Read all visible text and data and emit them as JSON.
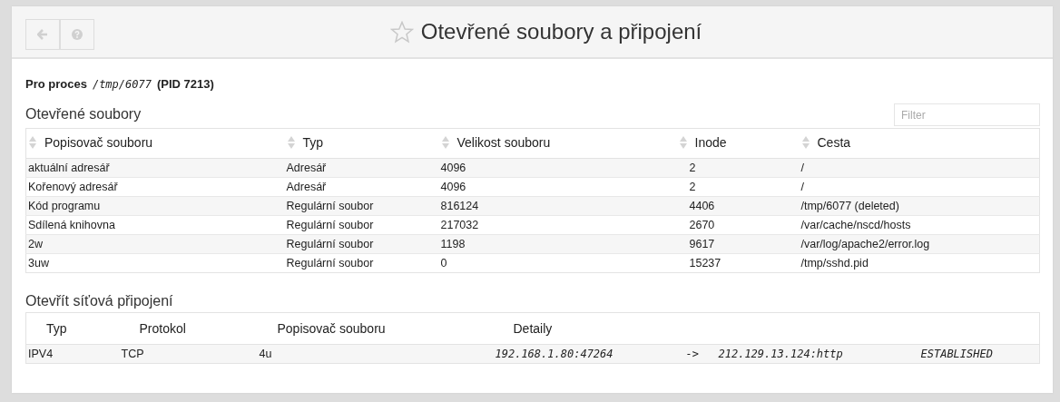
{
  "header": {
    "title": "Otevřené soubory a připojení",
    "favorite": false
  },
  "process": {
    "label": "Pro proces",
    "path": "/tmp/6077",
    "pid": "(PID 7213)"
  },
  "open_files": {
    "heading": "Otevřené soubory",
    "filter": {
      "placeholder": "Filter"
    },
    "columns": [
      "Popisovač souboru",
      "Typ",
      "Velikost souboru",
      "Inode",
      "Cesta"
    ],
    "rows": [
      [
        "aktuální adresář",
        "Adresář",
        "4096",
        "2",
        "/"
      ],
      [
        "Kořenový adresář",
        "Adresář",
        "4096",
        "2",
        "/"
      ],
      [
        "Kód programu",
        "Regulární soubor",
        "816124",
        "4406",
        "/tmp/6077 (deleted)"
      ],
      [
        "Sdílená knihovna",
        "Regulární soubor",
        "217032",
        "2670",
        "/var/cache/nscd/hosts"
      ],
      [
        "2w",
        "Regulární soubor",
        "1198",
        "9617",
        "/var/log/apache2/error.log"
      ],
      [
        "3uw",
        "Regulární soubor",
        "0",
        "15237",
        "/tmp/sshd.pid"
      ]
    ]
  },
  "network": {
    "heading": "Otevřít síťová připojení",
    "columns": [
      "Typ",
      "Protokol",
      "Popisovač souboru",
      "Detaily"
    ],
    "rows": [
      [
        "IPV4",
        "TCP",
        "4u",
        "192.168.1.80:47264",
        "->",
        "212.129.13.124:http",
        "ESTABLISHED"
      ]
    ]
  }
}
